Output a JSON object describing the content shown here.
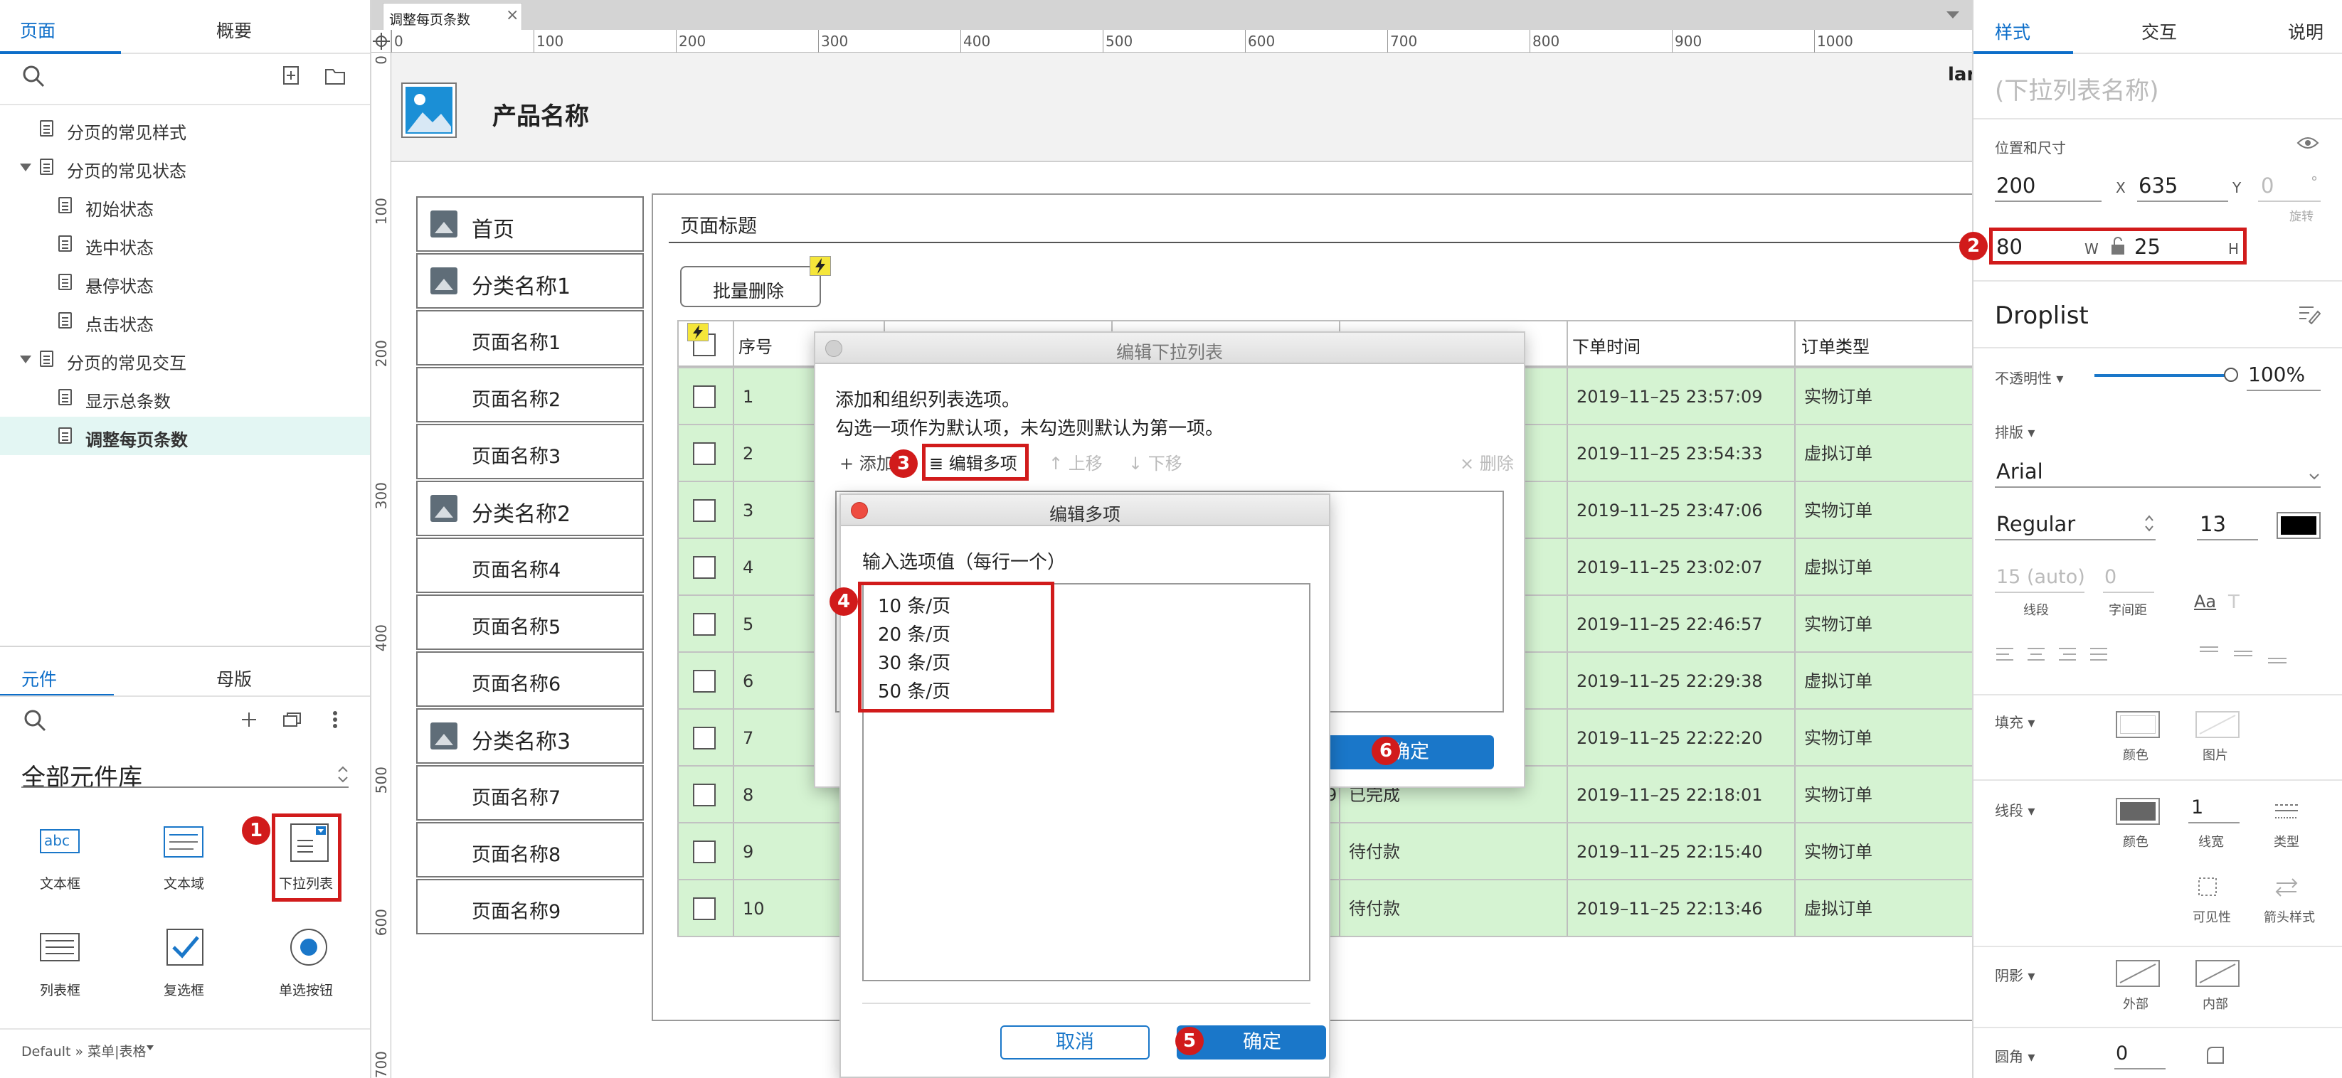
{
  "left_panel": {
    "tabs": {
      "pages": "页面",
      "outline": "概要"
    },
    "pages": [
      {
        "label": "分页的常见样式",
        "level": 0,
        "expandable": false,
        "selected": false
      },
      {
        "label": "分页的常见状态",
        "level": 0,
        "expandable": true,
        "selected": false
      },
      {
        "label": "初始状态",
        "level": 1,
        "expandable": false,
        "selected": false
      },
      {
        "label": "选中状态",
        "level": 1,
        "expandable": false,
        "selected": false
      },
      {
        "label": "悬停状态",
        "level": 1,
        "expandable": false,
        "selected": false
      },
      {
        "label": "点击状态",
        "level": 1,
        "expandable": false,
        "selected": false
      },
      {
        "label": "分页的常见交互",
        "level": 0,
        "expandable": true,
        "selected": false
      },
      {
        "label": "显示总条数",
        "level": 1,
        "expandable": false,
        "selected": false
      },
      {
        "label": "调整每页条数",
        "level": 1,
        "expandable": false,
        "selected": true
      }
    ],
    "widget_tabs": {
      "widgets": "元件",
      "masters": "母版"
    },
    "library_name": "全部元件库",
    "widgets": [
      {
        "label": "文本框",
        "icon": "text-field-icon"
      },
      {
        "label": "文本域",
        "icon": "text-area-icon"
      },
      {
        "label": "下拉列表",
        "icon": "droplist-icon"
      },
      {
        "label": "列表框",
        "icon": "list-box-icon"
      },
      {
        "label": "复选框",
        "icon": "checkbox-icon"
      },
      {
        "label": "单选按钮",
        "icon": "radio-button-icon"
      }
    ],
    "footer": "Default » 菜单|表格"
  },
  "canvas": {
    "tab_label": "调整每页条数",
    "ruler_top": [
      "0",
      "100",
      "200",
      "300",
      "400",
      "500",
      "600",
      "700",
      "800",
      "900",
      "1000"
    ],
    "ruler_left": [
      "0",
      "100",
      "200",
      "300",
      "400",
      "500",
      "600",
      "700"
    ],
    "product_name": "产品名称",
    "lan_fragment": "lar",
    "nav": [
      {
        "label": "首页",
        "type": "category"
      },
      {
        "label": "分类名称1",
        "type": "category"
      },
      {
        "label": "页面名称1",
        "type": "page"
      },
      {
        "label": "页面名称2",
        "type": "page"
      },
      {
        "label": "页面名称3",
        "type": "page"
      },
      {
        "label": "分类名称2",
        "type": "category"
      },
      {
        "label": "页面名称4",
        "type": "page"
      },
      {
        "label": "页面名称5",
        "type": "page"
      },
      {
        "label": "页面名称6",
        "type": "page"
      },
      {
        "label": "分类名称3",
        "type": "category"
      },
      {
        "label": "页面名称7",
        "type": "page"
      },
      {
        "label": "页面名称8",
        "type": "page"
      },
      {
        "label": "页面名称9",
        "type": "page"
      }
    ],
    "page_title": "页面标题",
    "batch_delete": "批量删除",
    "table_headers": {
      "index": "序号",
      "order_time": "下单时间",
      "order_type": "订单类型"
    },
    "table_rows": [
      {
        "index": "1",
        "status": "",
        "order_time": "2019–11–25 23:57:09",
        "order_type": "实物订单"
      },
      {
        "index": "2",
        "status": "",
        "order_time": "2019–11–25 23:54:33",
        "order_type": "虚拟订单"
      },
      {
        "index": "3",
        "status": "",
        "order_time": "2019–11–25 23:47:06",
        "order_type": "实物订单"
      },
      {
        "index": "4",
        "status": "",
        "order_time": "2019–11–25 23:02:07",
        "order_type": "虚拟订单"
      },
      {
        "index": "5",
        "status": "",
        "order_time": "2019–11–25 22:46:57",
        "order_type": "实物订单"
      },
      {
        "index": "6",
        "status": "",
        "order_time": "2019–11–25 22:29:38",
        "order_type": "虚拟订单"
      },
      {
        "index": "7",
        "status": "",
        "order_time": "2019–11–25 22:22:20",
        "order_type": "实物订单"
      },
      {
        "index": "8",
        "status": "已完成",
        "order_time": "2019–11–25 22:18:01",
        "order_type": "实物订单"
      },
      {
        "index": "9",
        "status": "待付款",
        "order_time": "2019–11–25 22:15:40",
        "order_type": "实物订单"
      },
      {
        "index": "10",
        "status": "待付款",
        "order_time": "2019–11–25 22:13:46",
        "order_type": "虚拟订单"
      }
    ],
    "row8_fragment": "9"
  },
  "dialog_droplist": {
    "title": "编辑下拉列表",
    "desc1": "添加和组织列表选项。",
    "desc2": "勾选一项作为默认项，未勾选则默认为第一项。",
    "toolbar": {
      "add": "添加",
      "edit_multiple": "编辑多项",
      "move_up": "上移",
      "move_down": "下移",
      "delete": "删除"
    },
    "ok": "确定"
  },
  "dialog_multi": {
    "title": "编辑多项",
    "prompt": "输入选项值（每行一个）",
    "options": [
      "10 条/页",
      "20 条/页",
      "30 条/页",
      "50 条/页"
    ],
    "cancel": "取消",
    "ok": "确定"
  },
  "right_panel": {
    "tabs": {
      "style": "样式",
      "interaction": "交互",
      "notes": "说明"
    },
    "widget_name_placeholder": "(下拉列表名称)",
    "position_size_label": "位置和尺寸",
    "x": "200",
    "x_label": "X",
    "y": "635",
    "y_label": "Y",
    "rotation": "0",
    "rotation_unit": "°",
    "rotation_label": "旋转",
    "w": "80",
    "w_label": "W",
    "h": "25",
    "h_label": "H",
    "style_name": "Droplist",
    "opacity_label": "不透明性",
    "opacity_value": "100%",
    "opacity_level": 1.0,
    "typography_label": "排版",
    "font": "Arial",
    "font_weight": "Regular",
    "font_size": "13",
    "line_height": "15 (auto)",
    "letter_spacing": "0",
    "line_height_label": "线段",
    "letter_spacing_label": "字间距",
    "aa_label": "Aa",
    "fill_label": "填充",
    "fill_color_label": "颜色",
    "fill_image_label": "图片",
    "border_label": "线段",
    "border_color_label": "颜色",
    "border_width": "1",
    "border_width_label": "线宽",
    "border_type_label": "类型",
    "visibility_label": "可见性",
    "arrow_style_label": "箭头样式",
    "shadow_label": "阴影",
    "shadow_outer_label": "外部",
    "shadow_inner_label": "内部",
    "radius_label": "圆角",
    "radius_value": "0"
  },
  "badges": [
    "1",
    "2",
    "3",
    "4",
    "5",
    "6"
  ],
  "colors": {
    "accent": "#0d6ec9",
    "highlight_red": "#d11b1b",
    "row_green": "#d5f3d2",
    "selected_page": "#e3f6f3"
  }
}
